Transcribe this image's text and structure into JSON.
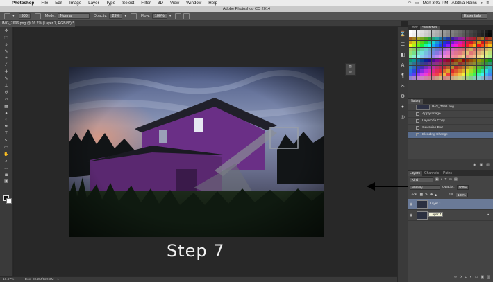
{
  "menubar": {
    "app_name": "Photoshop",
    "items": [
      "File",
      "Edit",
      "Image",
      "Layer",
      "Type",
      "Select",
      "Filter",
      "3D",
      "View",
      "Window",
      "Help"
    ],
    "clock": "Mon 3:03 PM",
    "user": "Alethia Rains"
  },
  "window_title": "Adobe Photoshop CC 2014",
  "options": {
    "brush_size": "900",
    "mode_label": "Mode:",
    "mode_value": "Normal",
    "opacity_label": "Opacity:",
    "opacity_value": "29%",
    "flow_label": "Flow:",
    "flow_value": "100%",
    "workspace": "Essentials"
  },
  "document_tab": "IMG_7696.png @ 16.7% (Layer 1, RGB/8*) *",
  "canvas_caption": "Step 7",
  "status": {
    "zoom": "16.67%",
    "doc": "Doc: 80.2M/120.3M"
  },
  "panels": {
    "color_tabs": [
      "Color",
      "Swatches"
    ],
    "history_tab": "History",
    "history_snapshot": "IMG_7696.png",
    "history_items": [
      "Apply Image",
      "Layer Via Copy",
      "Gaussian Blur",
      "Blending Change"
    ],
    "layers_tabs": [
      "Layers",
      "Channels",
      "Paths"
    ],
    "kind_label": "Kind",
    "blend_mode": "Multiply",
    "opacity_label": "Opacity:",
    "opacity_value": "100%",
    "lock_label": "Lock:",
    "fill_label": "Fill:",
    "fill_value": "100%",
    "layers": [
      "Layer 1",
      "Layer 7"
    ],
    "tooltip": "Layer 7"
  },
  "colors": {
    "accent_selection": "#5a6e8f",
    "arrow": "#000000"
  }
}
